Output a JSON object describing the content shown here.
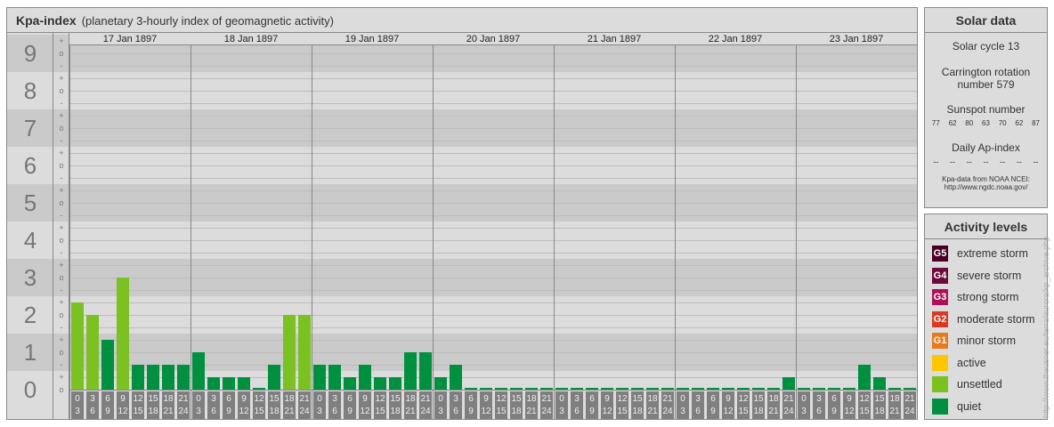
{
  "header": {
    "title": "Kpa-index",
    "subtitle": "(planetary 3-hourly index of geomagnetic activity)"
  },
  "colors": {
    "quiet": "#00903f",
    "unsettled": "#7ac121",
    "active": "#fcc600",
    "G1": "#e87a1c",
    "G2": "#d83a22",
    "G3": "#b0105a",
    "G4": "#6c0a3c",
    "G5": "#4a0024"
  },
  "chart_data": {
    "type": "bar",
    "title": "Kpa-index",
    "ylim": [
      0,
      9
    ],
    "y_ticks": [
      "0",
      "1",
      "2",
      "3",
      "4",
      "5",
      "6",
      "7",
      "8",
      "9"
    ],
    "minor_ticks": [
      "-",
      "o",
      "+"
    ],
    "intervals": [
      [
        "0",
        "3"
      ],
      [
        "3",
        "6"
      ],
      [
        "6",
        "9"
      ],
      [
        "9",
        "12"
      ],
      [
        "12",
        "15"
      ],
      [
        "15",
        "18"
      ],
      [
        "18",
        "21"
      ],
      [
        "21",
        "24"
      ]
    ],
    "days": [
      {
        "date": "17 Jan 1897",
        "values": [
          2.33,
          2,
          1.33,
          3,
          0.67,
          0.67,
          0.67,
          0.67
        ]
      },
      {
        "date": "18 Jan 1897",
        "values": [
          1,
          0.33,
          0.33,
          0.33,
          0,
          0.67,
          2,
          2
        ]
      },
      {
        "date": "19 Jan 1897",
        "values": [
          0.67,
          0.67,
          0.33,
          0.67,
          0.33,
          0.33,
          1,
          1
        ]
      },
      {
        "date": "20 Jan 1897",
        "values": [
          0.33,
          0.67,
          0,
          0,
          0,
          0,
          0,
          0
        ]
      },
      {
        "date": "21 Jan 1897",
        "values": [
          0,
          0,
          0,
          0,
          0,
          0,
          0,
          0
        ]
      },
      {
        "date": "22 Jan 1897",
        "values": [
          0,
          0,
          0,
          0,
          0,
          0,
          0,
          0.33
        ]
      },
      {
        "date": "23 Jan 1897",
        "values": [
          0,
          0,
          0,
          0,
          0.67,
          0.33,
          0,
          0
        ]
      }
    ]
  },
  "solar": {
    "title": "Solar data",
    "cycle": "Solar cycle 13",
    "carrington_1": "Carrington rotation",
    "carrington_2": "number 579",
    "sunspot_label": "Sunspot number",
    "sunspots": [
      "77",
      "62",
      "80",
      "63",
      "70",
      "62",
      "87"
    ],
    "ap_label": "Daily Ap-index",
    "ap": [
      "--",
      "--",
      "--",
      "--",
      "--",
      "--",
      "--"
    ],
    "source_1": "Kpa-data from NOAA NCEI:",
    "source_2": "http://www.ngdc.noaa.gov/"
  },
  "levels": {
    "title": "Activity levels",
    "items": [
      {
        "code": "G5",
        "label": "extreme storm",
        "color": "#4a0024"
      },
      {
        "code": "G4",
        "label": "severe storm",
        "color": "#6c0a3c"
      },
      {
        "code": "G3",
        "label": "strong storm",
        "color": "#b0105a"
      },
      {
        "code": "G2",
        "label": "moderate storm",
        "color": "#d83a22"
      },
      {
        "code": "G1",
        "label": "minor storm",
        "color": "#e87a1c"
      },
      {
        "code": "",
        "label": "active",
        "color": "#fcc600"
      },
      {
        "code": "",
        "label": "unsettled",
        "color": "#7ac121"
      },
      {
        "code": "",
        "label": "quiet",
        "color": "#00903f"
      }
    ]
  },
  "watermark": "http://www.theusner.eu/terra/aurora/kp_archive.php"
}
